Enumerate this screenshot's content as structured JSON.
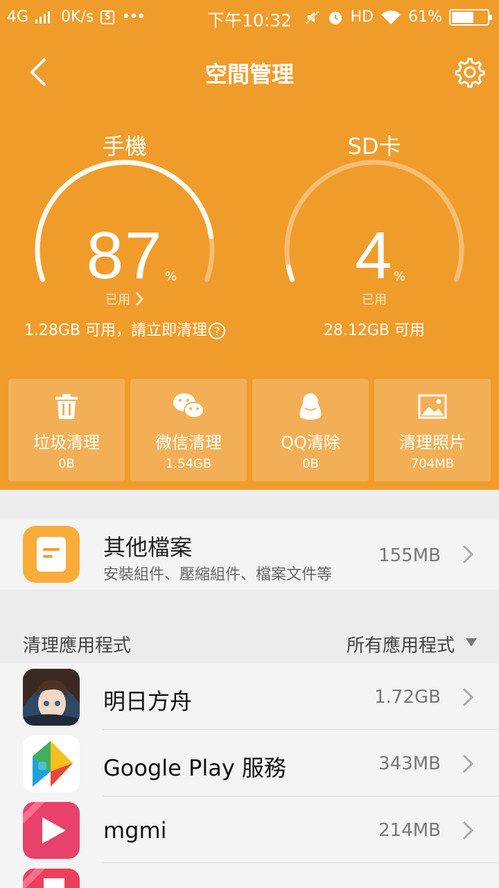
{
  "status_bar": {
    "network": "4G",
    "speed": "0K/s",
    "s_badge": "S",
    "more": "•••",
    "time": "下午10:32",
    "hd": "HD",
    "battery_text": "61%",
    "battery_level": 0.61
  },
  "header": {
    "title": "空間管理"
  },
  "phone_gauge": {
    "label": "手機",
    "value": "87",
    "percent_sign": "%",
    "used_label": "已用",
    "free_text": "1.28GB 可用，請立即清理",
    "help": "?",
    "fraction": 0.87
  },
  "sd_gauge": {
    "label": "SD卡",
    "value": "4",
    "percent_sign": "%",
    "used_label": "已用",
    "free_text": "28.12GB 可用",
    "fraction": 0.04
  },
  "tiles": [
    {
      "icon": "trash-icon",
      "name": "垃圾清理",
      "size": "0B"
    },
    {
      "icon": "wechat-icon",
      "name": "微信清理",
      "size": "1.54GB"
    },
    {
      "icon": "qq-penguin-icon",
      "name": "QQ清除",
      "size": "0B"
    },
    {
      "icon": "photo-icon",
      "name": "清理照片",
      "size": "704MB"
    }
  ],
  "other_files": {
    "name": "其他檔案",
    "desc": "安裝組件、壓縮組件、檔案文件等",
    "size": "155MB"
  },
  "apps_section": {
    "title": "清理應用程式",
    "filter": "所有應用程式"
  },
  "apps": [
    {
      "name": "明日方舟",
      "size": "1.72GB"
    },
    {
      "name": "Google Play 服務",
      "size": "343MB"
    },
    {
      "name": "mgmi",
      "size": "214MB"
    },
    {
      "name": "",
      "size": ""
    }
  ],
  "colors": {
    "accent": "#f09c2b",
    "folder": "#f8ad3a"
  }
}
